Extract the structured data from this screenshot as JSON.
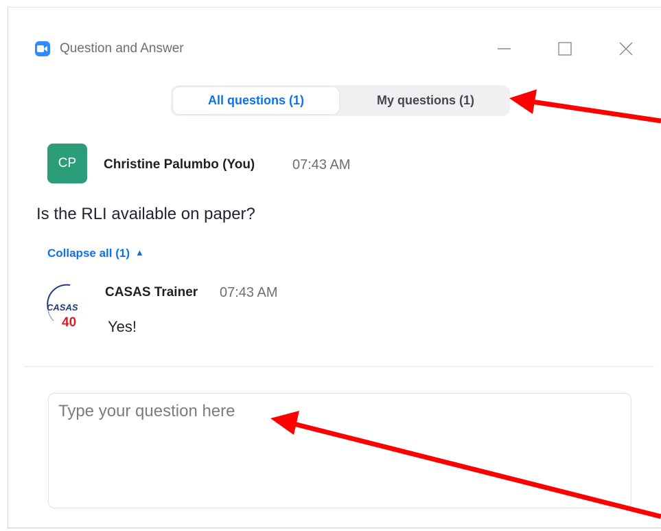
{
  "window": {
    "title": "Question and Answer",
    "app_icon": "zoom-video-icon",
    "controls": [
      "minimize-icon",
      "maximize-icon",
      "close-icon"
    ]
  },
  "tabs": {
    "all_label": "All questions (1)",
    "mine_label": "My questions (1)",
    "selected": "All questions (1)"
  },
  "question": {
    "avatar_initials": "CP",
    "avatar_color": "#2b9e79",
    "author": "Christine Palumbo (You)",
    "time": "07:43 AM",
    "text": "Is the RLI available on paper?"
  },
  "collapse": {
    "label": "Collapse all (1)",
    "icon": "chevron-up-icon"
  },
  "answer": {
    "author": "CASAS Trainer",
    "time": "07:43 AM",
    "text": "Yes!",
    "avatar_logo_text": "CASAS",
    "avatar_logo_number": "40"
  },
  "input": {
    "placeholder": "Type your question here",
    "value": ""
  },
  "colors": {
    "accent": "#0e71eb",
    "app_icon": "#2d8cff",
    "annotation_arrow": "#ff0000"
  }
}
